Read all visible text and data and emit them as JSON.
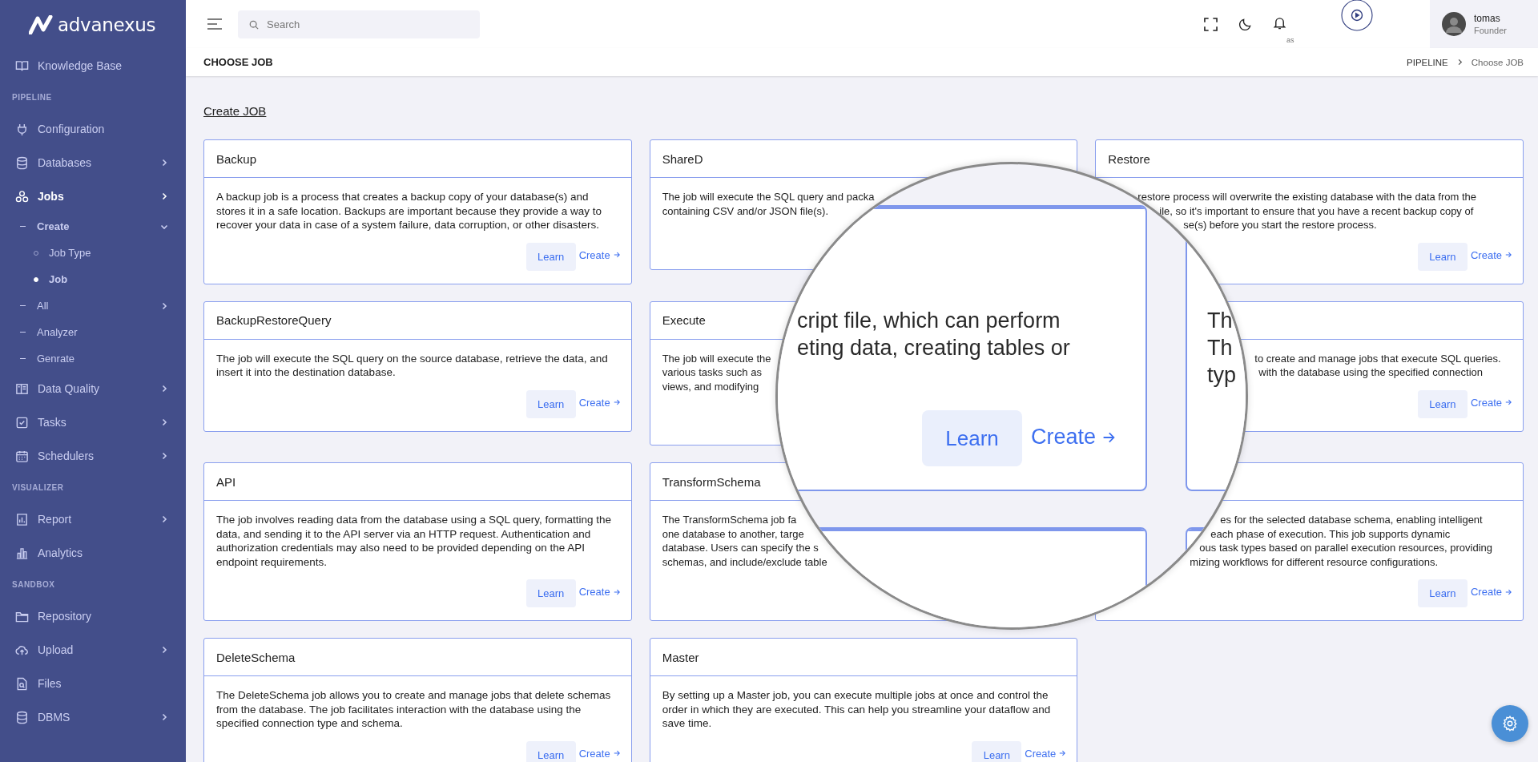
{
  "sidebar": {
    "logo": "advanexus",
    "items": [
      {
        "kind": "link",
        "label": "Knowledge Base",
        "selected": false
      },
      {
        "kind": "section",
        "label": "PIPELINE"
      },
      {
        "kind": "link",
        "label": "Configuration",
        "selected": false
      },
      {
        "kind": "link",
        "label": "Databases",
        "selected": false,
        "expanded": false
      },
      {
        "kind": "link",
        "label": "Jobs",
        "selected": true,
        "expanded": false,
        "children": [
          {
            "label": "Create",
            "selected": true,
            "expanded": true,
            "children": [
              {
                "label": "Job Type",
                "selected": false
              },
              {
                "label": "Job",
                "selected": true
              }
            ]
          },
          {
            "label": "All",
            "selected": false,
            "expanded": false
          },
          {
            "label": "Analyzer",
            "selected": false
          },
          {
            "label": "Genrate",
            "selected": false
          }
        ]
      },
      {
        "kind": "link",
        "label": "Data Quality",
        "selected": false,
        "expanded": false
      },
      {
        "kind": "link",
        "label": "Tasks",
        "selected": false,
        "expanded": false
      },
      {
        "kind": "link",
        "label": "Schedulers",
        "selected": false,
        "expanded": false
      },
      {
        "kind": "section",
        "label": "VISUALIZER"
      },
      {
        "kind": "link",
        "label": "Report",
        "selected": false,
        "expanded": false
      },
      {
        "kind": "link",
        "label": "Analytics",
        "selected": false
      },
      {
        "kind": "section",
        "label": "SANDBOX"
      },
      {
        "kind": "link",
        "label": "Repository",
        "selected": false
      },
      {
        "kind": "link",
        "label": "Upload",
        "selected": false,
        "expanded": false
      },
      {
        "kind": "link",
        "label": "Files",
        "selected": false
      },
      {
        "kind": "link",
        "label": "DBMS",
        "selected": false,
        "expanded": false
      }
    ]
  },
  "header": {
    "search": {
      "placeholder": "Search"
    },
    "stray_text": "as",
    "user": {
      "name": "tomas",
      "role": "Founder"
    }
  },
  "page": {
    "title": "CHOOSE JOB",
    "breadcrumb": [
      "PIPELINE",
      "Choose JOB"
    ],
    "heading": "Create JOB"
  },
  "cards": [
    {
      "title": "Backup",
      "text": "A backup job is a process that creates a backup copy of your database(s) and stores it in a safe location. Backups are important because they provide a way to recover your data in case of a system failure, data corruption, or other disasters.",
      "learn": "Learn",
      "create": "Create"
    },
    {
      "title": "ShareD",
      "lines": [
        "The job will execute the SQL query and packa",
        "containing CSV and/or JSON file(s)."
      ]
    },
    {
      "title": "Restore",
      "lines": [
        "restore process will overwrite the existing database with the data from the",
        "ile, so it's important to ensure that you have a recent backup copy of",
        "se(s) before you start the restore process."
      ],
      "learn": "Learn",
      "create": "Create"
    },
    {
      "title": "BackupRestoreQuery",
      "text": "The job will execute the SQL query on the source database, retrieve the data, and insert it into the destination database.",
      "learn": "Learn",
      "create": "Create"
    },
    {
      "title": "Execute",
      "lines": [
        "The job will execute the",
        "various tasks such as",
        "views, and modifying"
      ]
    },
    {
      "lines": [
        "to create and manage jobs that execute SQL queries.",
        "with the database using the specified connection"
      ],
      "learn": "Learn",
      "create": "Create"
    },
    {
      "title": "API",
      "text": "The job involves reading data from the database using a SQL query, formatting the data, and sending it to the API server via an HTTP request. Authentication and authorization credentials may also need to be provided depending on the API endpoint requirements.",
      "learn": "Learn",
      "create": "Create"
    },
    {
      "title": "TransformSchema",
      "lines": [
        "The TransformSchema job fa",
        "one database to another, targe",
        "database. Users can specify the s",
        "schemas, and include/exclude table"
      ]
    },
    {
      "lines": [
        "es for the selected database schema, enabling intelligent",
        "each phase of execution. This job supports dynamic",
        "ous task types based on parallel execution resources, providing",
        "mizing workflows for different resource configurations."
      ],
      "learn": "Learn",
      "create": "Create"
    },
    {
      "title": "DeleteSchema",
      "text": "The DeleteSchema job allows you to create and manage jobs that delete schemas from the database. The job facilitates interaction with the database using the specified connection type and schema.",
      "learn": "Learn",
      "create": "Create"
    },
    {
      "title": "Master",
      "text": "By setting up a Master job, you can execute multiple jobs at once and control the order in which they are executed. This can help you streamline your dataflow and save time.",
      "learn": "Learn",
      "create": "Create"
    }
  ],
  "magnifier": {
    "lines": [
      "cript file, which can perform",
      "eting data, creating tables or"
    ],
    "learn": "Learn",
    "create": "Create",
    "side_lines": [
      "Th",
      "Th",
      "typ"
    ]
  }
}
